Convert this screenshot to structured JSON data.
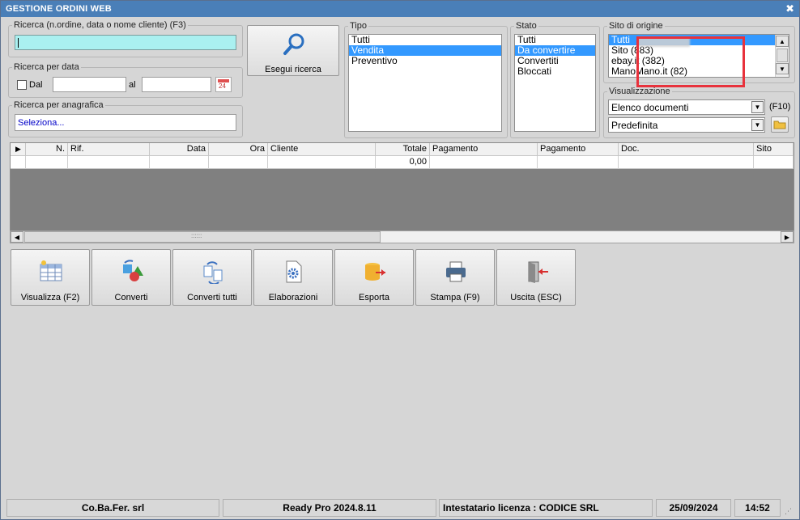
{
  "window": {
    "title": "GESTIONE ORDINI WEB",
    "close_glyph": "✖"
  },
  "search": {
    "legend": "Ricerca (n.ordine, data o nome cliente) (F3)",
    "value": "",
    "button_label": "Esegui ricerca"
  },
  "date_search": {
    "legend": "Ricerca per data",
    "from_label": "Dal",
    "to_label": "al",
    "calendar_day": "24",
    "from_value": "",
    "to_value": ""
  },
  "registry_search": {
    "legend": "Ricerca per anagrafica",
    "value": "Seleziona..."
  },
  "tipo": {
    "legend": "Tipo",
    "items": [
      "Tutti",
      "Vendita",
      "Preventivo"
    ],
    "selected": "Vendita"
  },
  "stato": {
    "legend": "Stato",
    "items": [
      "Tutti",
      "Da convertire",
      "Convertiti",
      "Bloccati"
    ],
    "selected": "Da convertire"
  },
  "sito": {
    "legend": "Sito di origine",
    "items": [
      "Tutti",
      "Sito (883)",
      "ebay.it (382)",
      "ManoMano.it (82)"
    ],
    "selected": "Tutti",
    "highlight_color": "#e8323c"
  },
  "visualizzazione": {
    "legend": "Visualizzazione",
    "view_value": "Elenco documenti",
    "shortcut": "(F10)",
    "preset_value": "Predefinita"
  },
  "grid": {
    "columns": [
      "N.",
      "Rif.",
      "Data",
      "Ora",
      "Cliente",
      "Totale",
      "Pagamento",
      "Pagamento",
      "Doc.",
      "Sito"
    ],
    "row": [
      "",
      "",
      "",
      "",
      "",
      "0,00",
      "",
      "",
      "",
      ""
    ],
    "scroll_grip": "::::::"
  },
  "actions": [
    {
      "label": "Visualizza (F2)",
      "icon": "table-view-icon"
    },
    {
      "label": "Converti",
      "icon": "convert-icon"
    },
    {
      "label": "Converti tutti",
      "icon": "convert-all-icon"
    },
    {
      "label": "Elaborazioni",
      "icon": "process-document-icon"
    },
    {
      "label": "Esporta",
      "icon": "export-database-icon"
    },
    {
      "label": "Stampa (F9)",
      "icon": "printer-icon"
    },
    {
      "label": "Uscita (ESC)",
      "icon": "exit-door-icon"
    }
  ],
  "status": {
    "company": "Co.Ba.Fer. srl",
    "product": "Ready Pro 2024.8.11",
    "license": "Intestatario licenza : CODICE SRL",
    "date": "25/09/2024",
    "time": "14:52"
  },
  "colors": {
    "title_bar": "#4a7fb8",
    "search_field": "#aaf0f0",
    "selection": "#3399ff",
    "grid_bg": "#808080"
  }
}
